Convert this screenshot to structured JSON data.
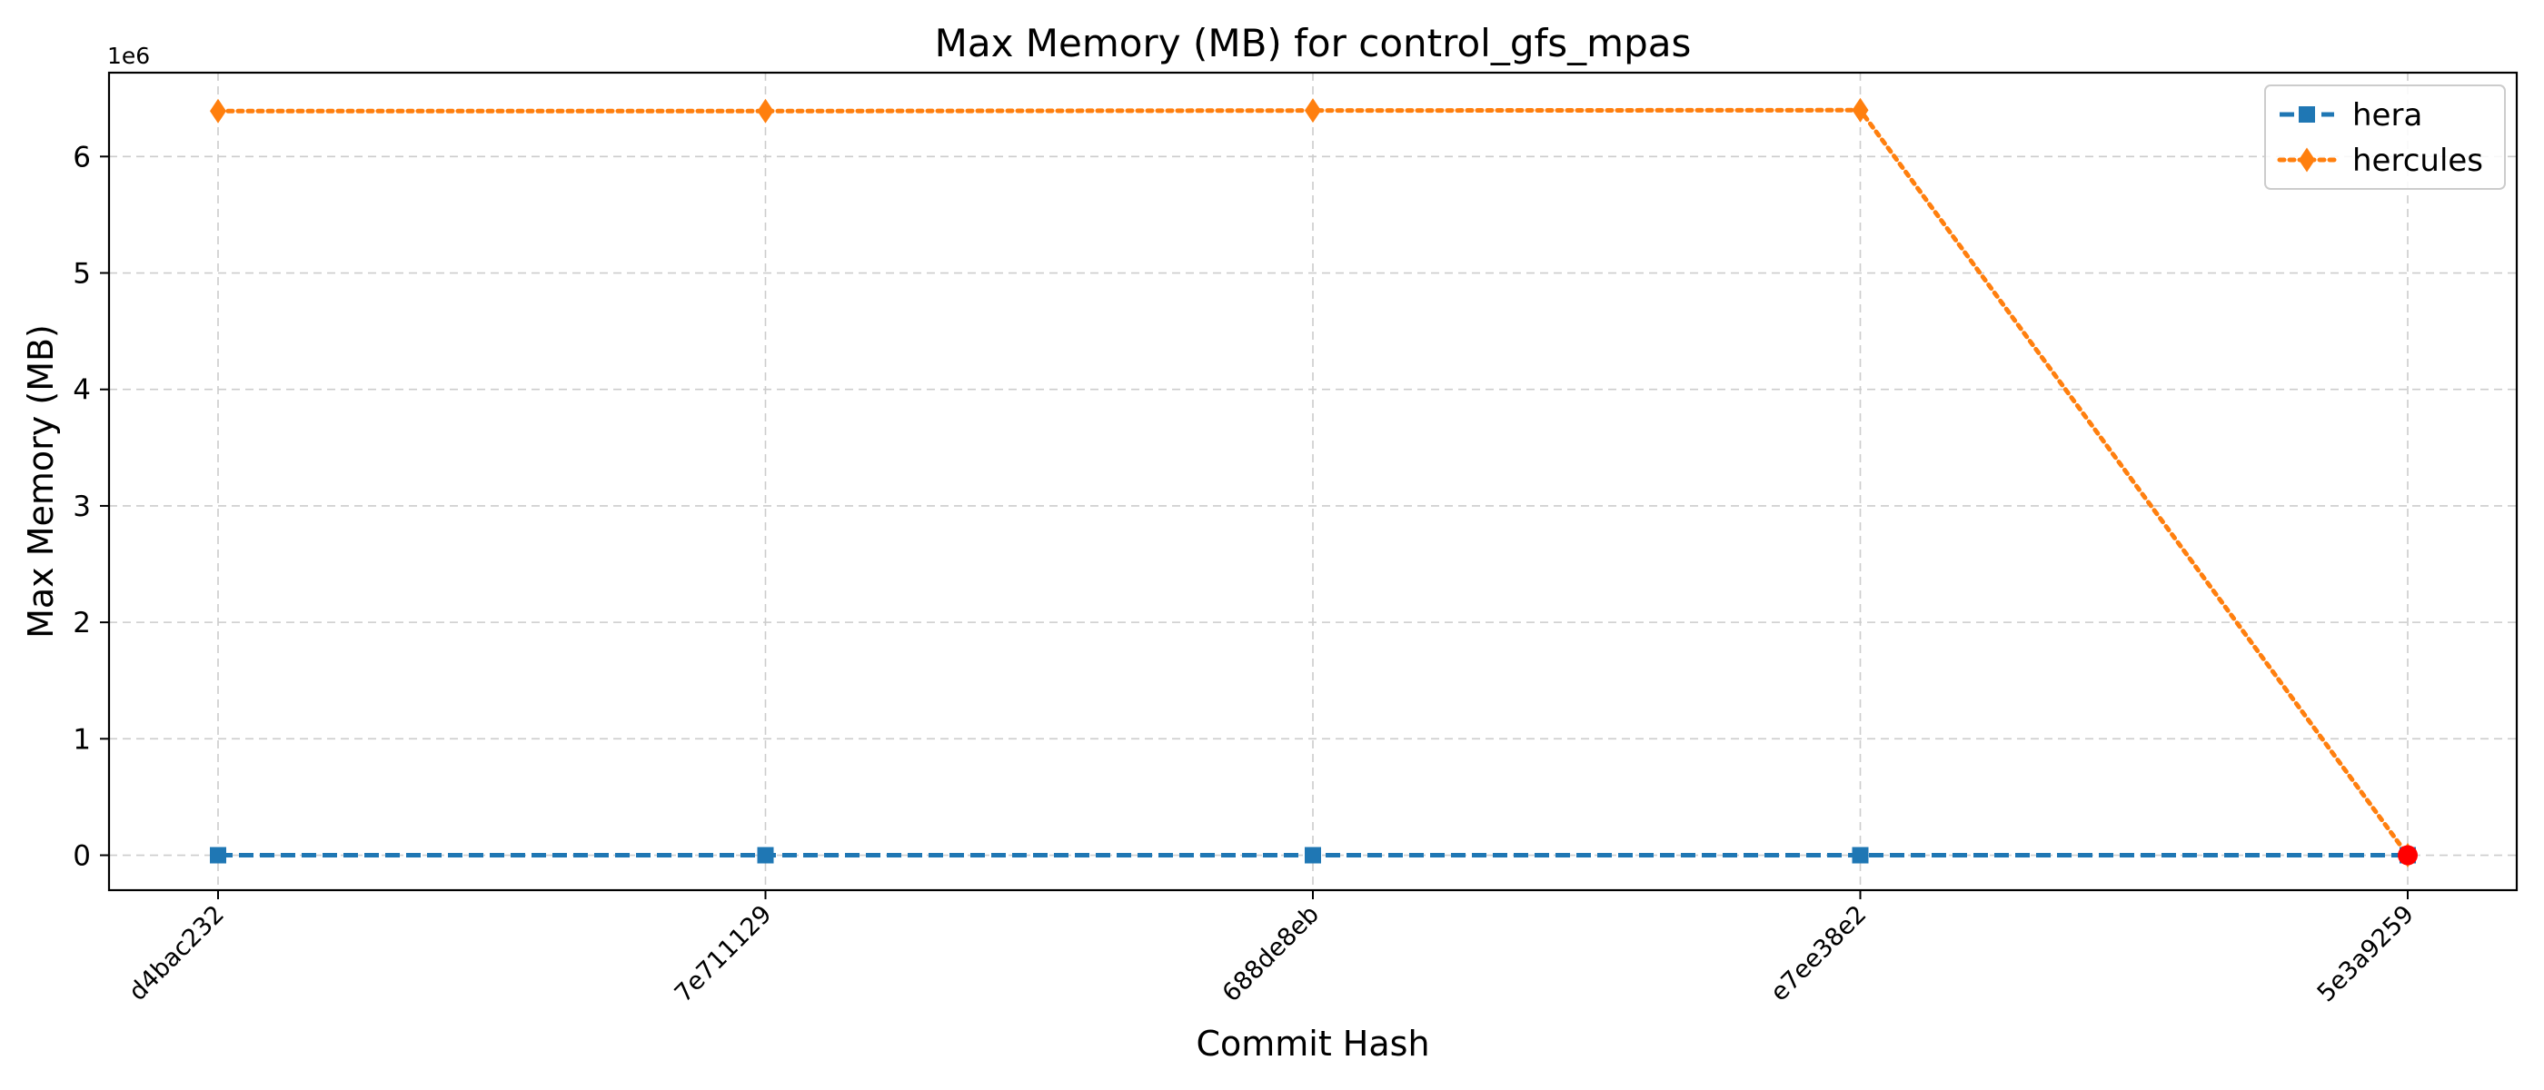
{
  "chart_data": {
    "type": "line",
    "title": "Max Memory (MB) for control_gfs_mpas",
    "xlabel": "Commit Hash",
    "ylabel": "Max Memory (MB)",
    "y_offset_label": "1e6",
    "categories": [
      "d4bac232",
      "7e711129",
      "688de8eb",
      "e7ee38e2",
      "5e3a9259"
    ],
    "y_ticks": [
      0,
      1,
      2,
      3,
      4,
      5,
      6
    ],
    "ylim": [
      -0.3,
      6.72
    ],
    "grid": true,
    "legend_position": "top-right",
    "series": [
      {
        "name": "hera",
        "values": [
          0,
          0,
          0,
          0,
          0
        ],
        "color": "#1f77b4",
        "line_style": "dashed",
        "marker": "square"
      },
      {
        "name": "hercules",
        "values": [
          6.39,
          6.39,
          6.395,
          6.398,
          0
        ],
        "color": "#ff7f0e",
        "line_style": "dotted",
        "marker": "diamond"
      }
    ],
    "highlight": {
      "category": "5e3a9259",
      "value": 0,
      "color": "#ff0000",
      "marker": "circle"
    }
  }
}
